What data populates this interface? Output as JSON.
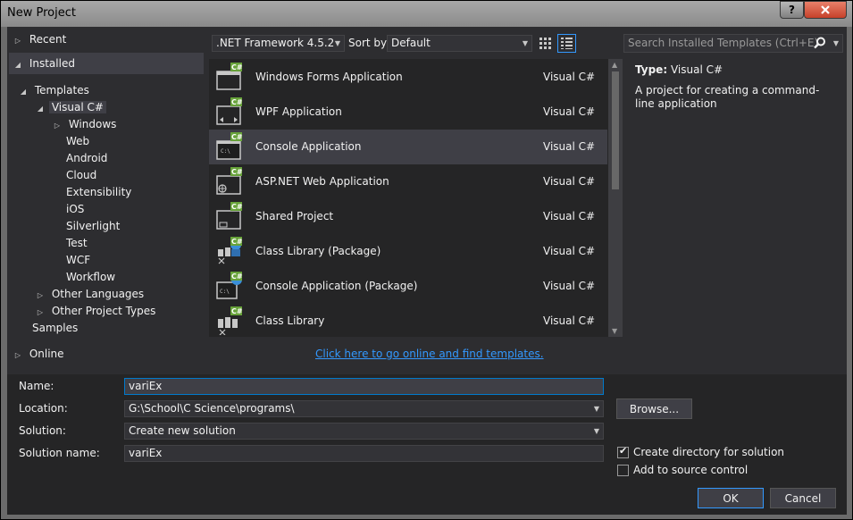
{
  "window": {
    "title": "New Project",
    "help": "?",
    "close": "x"
  },
  "tree": {
    "recent": "Recent",
    "installed": "Installed",
    "templates": "Templates",
    "visual_csharp": "Visual C#",
    "windows": "Windows",
    "children": [
      "Web",
      "Android",
      "Cloud",
      "Extensibility",
      "iOS",
      "Silverlight",
      "Test",
      "WCF",
      "Workflow"
    ],
    "other_languages": "Other Languages",
    "other_project_types": "Other Project Types",
    "samples": "Samples",
    "online": "Online"
  },
  "toolbar": {
    "framework": ".NET Framework 4.5.2",
    "sort_label": "Sort by:",
    "sort_value": "Default",
    "search_placeholder": "Search Installed Templates (Ctrl+E)"
  },
  "templates": [
    {
      "name": "Windows Forms Application",
      "lang": "Visual C#",
      "icon": "windows-forms-icon"
    },
    {
      "name": "WPF Application",
      "lang": "Visual C#",
      "icon": "wpf-icon"
    },
    {
      "name": "Console Application",
      "lang": "Visual C#",
      "icon": "console-icon",
      "selected": true
    },
    {
      "name": "ASP.NET Web Application",
      "lang": "Visual C#",
      "icon": "web-app-icon"
    },
    {
      "name": "Shared Project",
      "lang": "Visual C#",
      "icon": "shared-project-icon"
    },
    {
      "name": "Class Library (Package)",
      "lang": "Visual C#",
      "icon": "class-library-package-icon"
    },
    {
      "name": "Console Application (Package)",
      "lang": "Visual C#",
      "icon": "console-package-icon"
    },
    {
      "name": "Class Library",
      "lang": "Visual C#",
      "icon": "class-library-icon"
    }
  ],
  "description": {
    "type_key": "Type:",
    "type_value": "Visual C#",
    "text": "A project for creating a command-line application"
  },
  "online_link": "Click here to go online and find templates.",
  "form": {
    "name_label": "Name:",
    "name_value": "variEx",
    "location_label": "Location:",
    "location_value": "G:\\School\\C Science\\programs\\",
    "solution_label": "Solution:",
    "solution_value": "Create new solution",
    "solution_name_label": "Solution name:",
    "solution_name_value": "variEx",
    "browse": "Browse...",
    "create_dir": "Create directory for solution",
    "create_dir_checked": true,
    "add_source": "Add to source control",
    "add_source_checked": false,
    "ok": "OK",
    "cancel": "Cancel"
  },
  "colors": {
    "accent": "#3399ff",
    "focus": "#007acc",
    "background": "#2d2d30",
    "csharp_badge": "#68a33a"
  }
}
